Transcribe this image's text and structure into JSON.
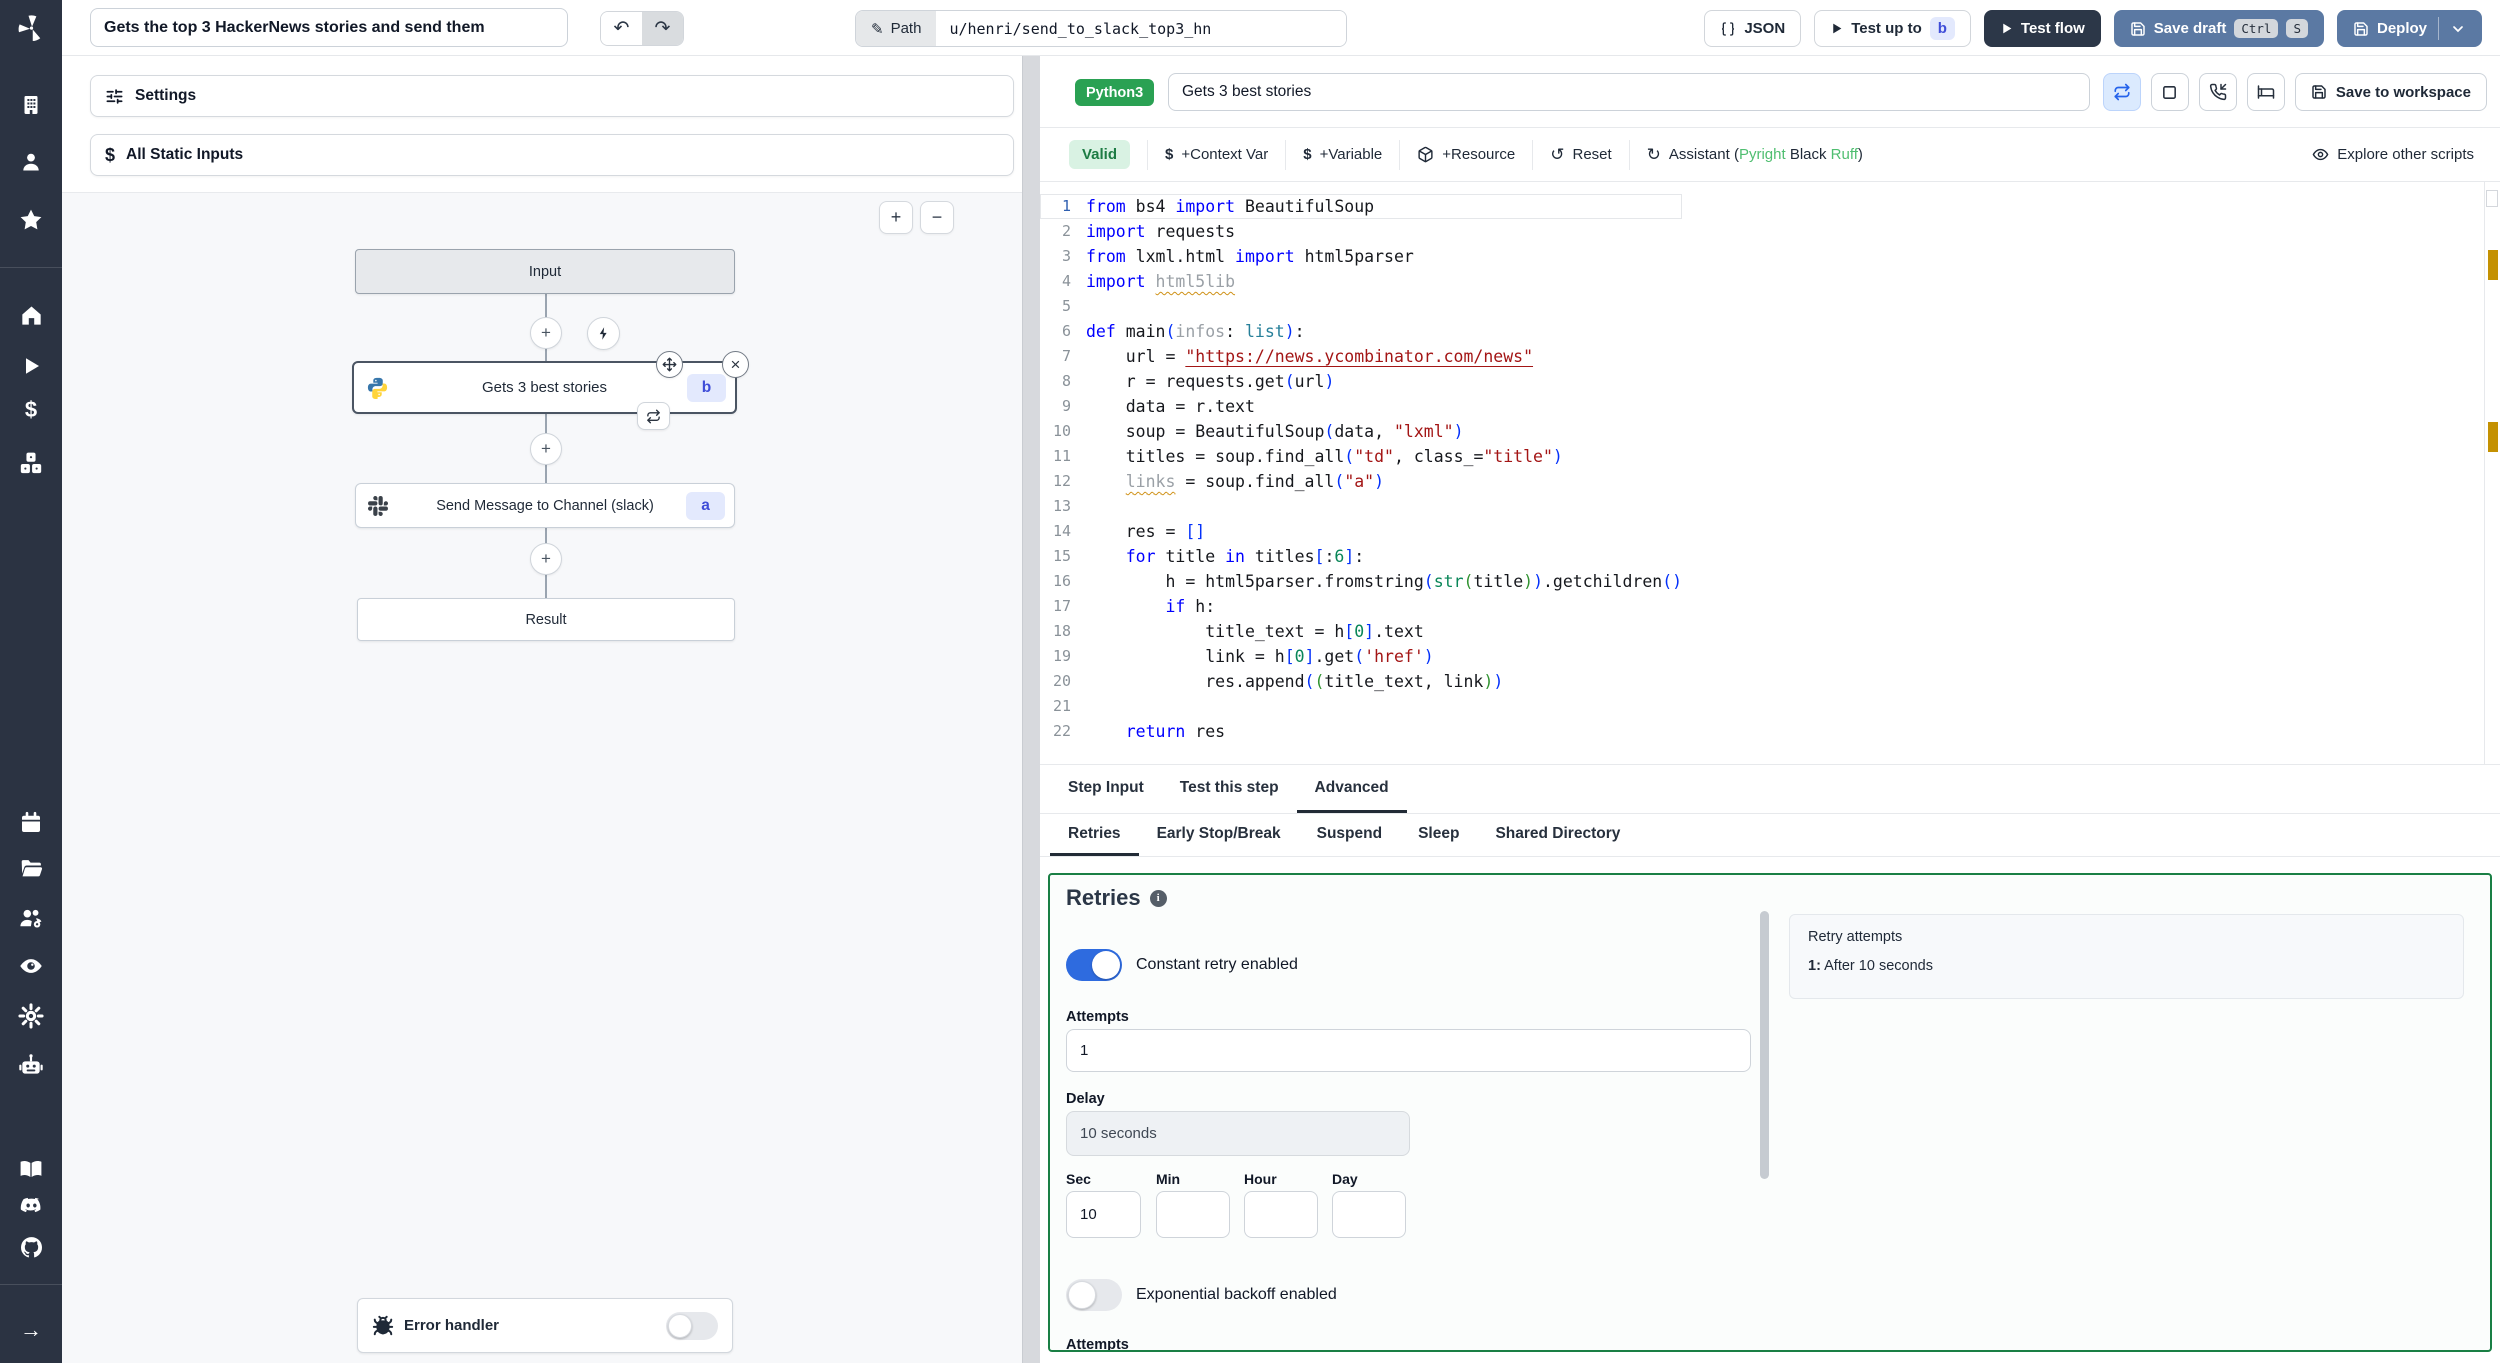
{
  "icons": {
    "undo": "↶",
    "redo": "↷",
    "pencil": "✎",
    "plus": "+",
    "minus": "−",
    "close": "×",
    "dollar": "$",
    "arrow_right": "→",
    "reset": "↺",
    "assistant_refresh": "↻",
    "info": "i",
    "star": "★"
  },
  "topbar": {
    "flow_title": "Gets the top 3 HackerNews stories and send them",
    "path_label": "Path",
    "path_value": "u/henri/send_to_slack_top3_hn",
    "json_label": "JSON",
    "test_up_to_label": "Test up to",
    "test_up_to_badge": "b",
    "test_flow_label": "Test flow",
    "save_draft_label": "Save draft",
    "kbd_ctrl": "Ctrl",
    "kbd_s": "S",
    "deploy_label": "Deploy"
  },
  "flow_panel": {
    "settings_label": "Settings",
    "static_inputs_label": "All Static Inputs",
    "input_node": "Input",
    "step_b_title": "Gets 3 best stories",
    "step_b_badge": "b",
    "step_a_title": "Send Message to Channel (slack)",
    "step_a_badge": "a",
    "result_node": "Result",
    "error_handler_label": "Error handler"
  },
  "editor": {
    "lang_badge": "Python3",
    "step_name": "Gets 3 best stories",
    "save_to_workspace_label": "Save to workspace",
    "valid_badge": "Valid",
    "context_var_label": "+Context Var",
    "variable_label": "+Variable",
    "resource_label": "+Resource",
    "reset_label": "Reset",
    "assistant_prefix": "Assistant (",
    "assistant_pyright": "Pyright",
    "assistant_black": "Black",
    "assistant_ruff": "Ruff",
    "assistant_suffix": ")",
    "explore_label": "Explore other scripts"
  },
  "tabs": {
    "items": [
      "Step Input",
      "Test this step",
      "Advanced"
    ],
    "active_index": 2
  },
  "subtabs": {
    "items": [
      "Retries",
      "Early Stop/Break",
      "Suspend",
      "Sleep",
      "Shared Directory"
    ],
    "active_index": 0
  },
  "retries": {
    "title": "Retries",
    "constant_label": "Constant retry enabled",
    "attempts_label": "Attempts",
    "attempts_value": "1",
    "delay_label": "Delay",
    "delay_value": "10 seconds",
    "unit_labels": [
      "Sec",
      "Min",
      "Hour",
      "Day"
    ],
    "sec_value": "10",
    "exp_label": "Exponential backoff enabled",
    "attempts2_label": "Attempts",
    "summary_title": "Retry attempts",
    "summary_item_n": "1:",
    "summary_item_text": "After 10 seconds"
  },
  "colors": {
    "sidebar": "#2b3342",
    "steel_blue": "#5b79a3",
    "dark_button": "#2c3748",
    "python_badge_green": "#2aa153",
    "valid_green_bg": "#d9f2e3",
    "retries_border_green": "#1a7f45",
    "toggle_blue": "#2e6bdf",
    "badge_indigo_bg": "#e3e9fd",
    "badge_indigo_text": "#3f4dd8",
    "warning_marker": "#c49102"
  },
  "code": {
    "lines": [
      [
        [
          "kw",
          "from"
        ],
        [
          "t",
          " bs4 "
        ],
        [
          "kw",
          "import"
        ],
        [
          "t",
          " BeautifulSoup"
        ]
      ],
      [
        [
          "kw",
          "import"
        ],
        [
          "t",
          " requests"
        ]
      ],
      [
        [
          "kw",
          "from"
        ],
        [
          "t",
          " lxml.html "
        ],
        [
          "kw",
          "import"
        ],
        [
          "t",
          " html5parser"
        ]
      ],
      [
        [
          "kw",
          "import"
        ],
        [
          "t",
          " "
        ],
        [
          "un",
          "html5lib"
        ]
      ],
      [],
      [
        [
          "kw",
          "def"
        ],
        [
          "t",
          " main"
        ],
        [
          "p1",
          "("
        ],
        [
          "dim",
          "infos"
        ],
        [
          "t",
          ": "
        ],
        [
          "ty",
          "list"
        ],
        [
          "p1",
          ")"
        ],
        [
          "t",
          ":"
        ]
      ],
      [
        [
          "t",
          "    url = "
        ],
        [
          "strl",
          "\"https://news.ycombinator.com/news\""
        ]
      ],
      [
        [
          "t",
          "    r = requests.get"
        ],
        [
          "p1",
          "("
        ],
        [
          "t",
          "url"
        ],
        [
          "p1",
          ")"
        ]
      ],
      [
        [
          "t",
          "    data = r.text"
        ]
      ],
      [
        [
          "t",
          "    soup = BeautifulSoup"
        ],
        [
          "p1",
          "("
        ],
        [
          "t",
          "data, "
        ],
        [
          "str",
          "\"lxml\""
        ],
        [
          "p1",
          ")"
        ]
      ],
      [
        [
          "t",
          "    titles = soup.find_all"
        ],
        [
          "p1",
          "("
        ],
        [
          "str",
          "\"td\""
        ],
        [
          "t",
          ", class_="
        ],
        [
          "str",
          "\"title\""
        ],
        [
          "p1",
          ")"
        ]
      ],
      [
        [
          "t",
          "    "
        ],
        [
          "un",
          "links"
        ],
        [
          "t",
          " = soup.find_all"
        ],
        [
          "p1",
          "("
        ],
        [
          "str",
          "\"a\""
        ],
        [
          "p1",
          ")"
        ]
      ],
      [],
      [
        [
          "t",
          "    res = "
        ],
        [
          "p1",
          "[]"
        ]
      ],
      [
        [
          "t",
          "    "
        ],
        [
          "kw",
          "for"
        ],
        [
          "t",
          " title "
        ],
        [
          "kw",
          "in"
        ],
        [
          "t",
          " titles"
        ],
        [
          "p1",
          "["
        ],
        [
          "t",
          ":"
        ],
        [
          "num",
          "6"
        ],
        [
          "p1",
          "]"
        ],
        [
          "t",
          ":"
        ]
      ],
      [
        [
          "t",
          "        h = html5parser.fromstring"
        ],
        [
          "p1",
          "("
        ],
        [
          "num",
          "str"
        ],
        [
          "p2",
          "("
        ],
        [
          "t",
          "title"
        ],
        [
          "p2",
          ")"
        ],
        [
          "p1",
          ")"
        ],
        [
          "t",
          ".getchildren"
        ],
        [
          "p1",
          "()"
        ]
      ],
      [
        [
          "t",
          "        "
        ],
        [
          "kw",
          "if"
        ],
        [
          "t",
          " h:"
        ]
      ],
      [
        [
          "t",
          "            title_text = h"
        ],
        [
          "p1",
          "["
        ],
        [
          "num",
          "0"
        ],
        [
          "p1",
          "]"
        ],
        [
          "t",
          ".text"
        ]
      ],
      [
        [
          "t",
          "            link = h"
        ],
        [
          "p1",
          "["
        ],
        [
          "num",
          "0"
        ],
        [
          "p1",
          "]"
        ],
        [
          "t",
          ".get"
        ],
        [
          "p1",
          "("
        ],
        [
          "str",
          "'href'"
        ],
        [
          "p1",
          ")"
        ]
      ],
      [
        [
          "t",
          "            res.append"
        ],
        [
          "p1",
          "("
        ],
        [
          "p2",
          "("
        ],
        [
          "t",
          "title_text, link"
        ],
        [
          "p2",
          ")"
        ],
        [
          "p1",
          ")"
        ]
      ],
      [],
      [
        [
          "t",
          "    "
        ],
        [
          "kw",
          "return"
        ],
        [
          "t",
          " res"
        ]
      ]
    ]
  }
}
